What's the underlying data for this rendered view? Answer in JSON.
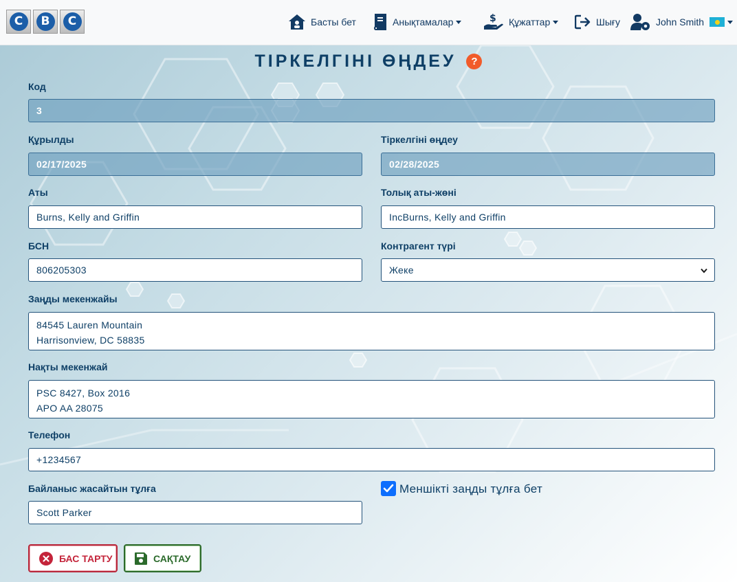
{
  "brand": {
    "letters": [
      "C",
      "B",
      "C"
    ]
  },
  "nav": {
    "home": "Басты бет",
    "references": "Анықтамалар",
    "documents": "Құжаттар",
    "logout": "Шығу",
    "user": "John Smith"
  },
  "page": {
    "title": "ТІРКЕЛГІНІ ӨҢДЕУ",
    "help": "?"
  },
  "form": {
    "code": {
      "label": "Код",
      "value": "3"
    },
    "created": {
      "label": "Құрылды",
      "value": "02/17/2025"
    },
    "modified": {
      "label": "Тіркелгіні өңдеу",
      "value": "02/28/2025"
    },
    "name": {
      "label": "Аты",
      "value": "Burns, Kelly and Griffin"
    },
    "full_name": {
      "label": "Толық аты-жөні",
      "value": "IncBurns, Kelly and Griffin"
    },
    "bin": {
      "label": "БСН",
      "value": "806205303"
    },
    "counterparty_type": {
      "label": "Контрагент түрі",
      "value": "Жеке"
    },
    "legal_address": {
      "label": "Заңды мекенжайы",
      "value": "84545 Lauren Mountain\nHarrisonview, DC 58835"
    },
    "actual_address": {
      "label": "Нақты мекенжай",
      "value": "PSC 8427, Box 2016\nAPO AA 28075"
    },
    "phone": {
      "label": "Телефон",
      "value": "+1234567"
    },
    "contact": {
      "label": "Байланыс жасайтын тұлға",
      "value": "Scott Parker"
    },
    "own_entity": {
      "label": "Меншікті заңды тұлға бет",
      "checked": true
    }
  },
  "buttons": {
    "cancel": "БАС ТАРТУ",
    "save": "САҚТАУ"
  },
  "colors": {
    "primary_text": "#0e3f66",
    "cancel": "#c4243a",
    "save": "#2b6a2b",
    "help": "#f15b2a",
    "checkbox": "#0d6efd"
  }
}
